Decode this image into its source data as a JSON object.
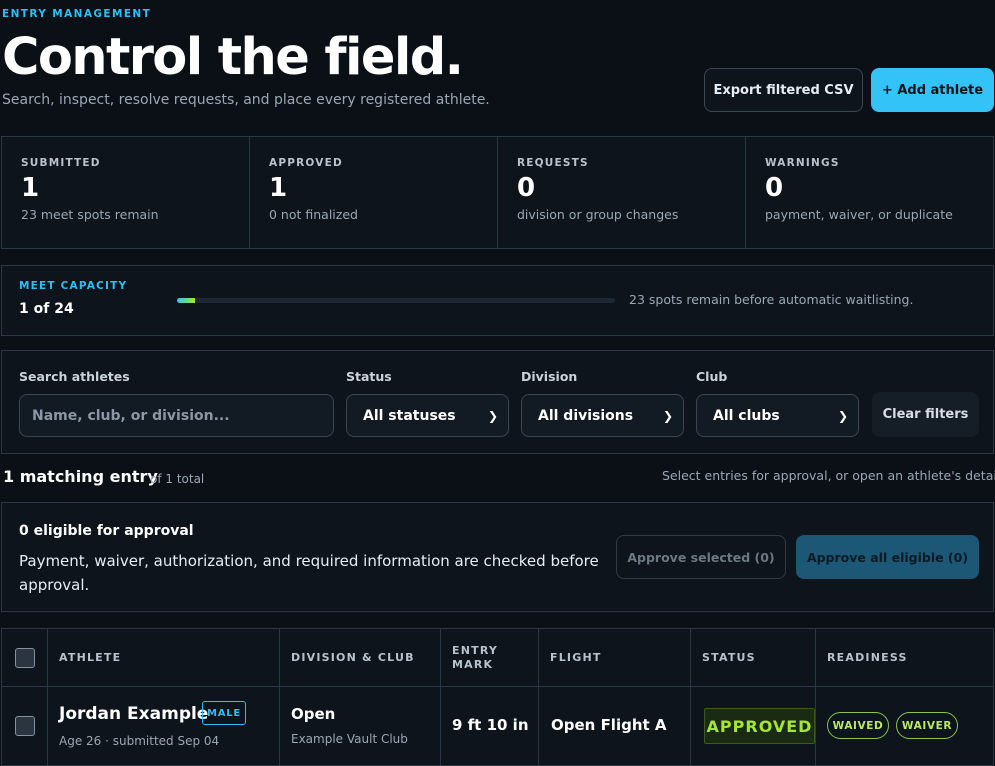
{
  "header": {
    "eyebrow": "ENTRY MANAGEMENT",
    "title": "Control the field.",
    "subtitle": "Search, inspect, resolve requests, and place every registered athlete.",
    "export_label": "Export filtered CSV",
    "add_label": "+ Add athlete"
  },
  "stats": [
    {
      "label": "SUBMITTED",
      "value": "1",
      "note": "23 meet spots remain"
    },
    {
      "label": "APPROVED",
      "value": "1",
      "note": "0 not finalized"
    },
    {
      "label": "REQUESTS",
      "value": "0",
      "note": "division or group changes"
    },
    {
      "label": "WARNINGS",
      "value": "0",
      "note": "payment, waiver, or duplicate"
    }
  ],
  "capacity": {
    "label": "MEET CAPACITY",
    "value": "1 of 24",
    "fill_fraction": 0.042,
    "note": "23 spots remain before automatic waitlisting."
  },
  "filters": {
    "search_label": "Search athletes",
    "search_placeholder": "Name, club, or division...",
    "status_label": "Status",
    "status_value": "All statuses",
    "division_label": "Division",
    "division_value": "All divisions",
    "club_label": "Club",
    "club_value": "All clubs",
    "clear_label": "Clear filters"
  },
  "results": {
    "title": "1 matching entry",
    "count": "of 1 total",
    "hint": "Select entries for approval, or open an athlete's details."
  },
  "approval": {
    "title": "0 eligible for approval",
    "text": "Payment, waiver, authorization, and required information are checked before approval.",
    "approve_selected_label": "Approve selected (0)",
    "approve_all_label": "Approve all eligible (0)"
  },
  "table": {
    "headers": [
      "ATHLETE",
      "DIVISION & CLUB",
      "ENTRY MARK",
      "FLIGHT",
      "STATUS",
      "READINESS"
    ],
    "rows": [
      {
        "name": "Jordan Example",
        "gender_tag": "MALE",
        "meta": "Age 26 · submitted Sep 04",
        "division": "Open",
        "club": "Example Vault Club",
        "entry_mark": "9 ft 10 in",
        "flight": "Open Flight A",
        "status": "APPROVED",
        "readiness": [
          "WAIVED",
          "WAIVER"
        ]
      }
    ]
  },
  "colors": {
    "accent": "#33c3f6",
    "background": "#0b1017",
    "panel": "#0e141c",
    "approved": "#a3e635"
  }
}
